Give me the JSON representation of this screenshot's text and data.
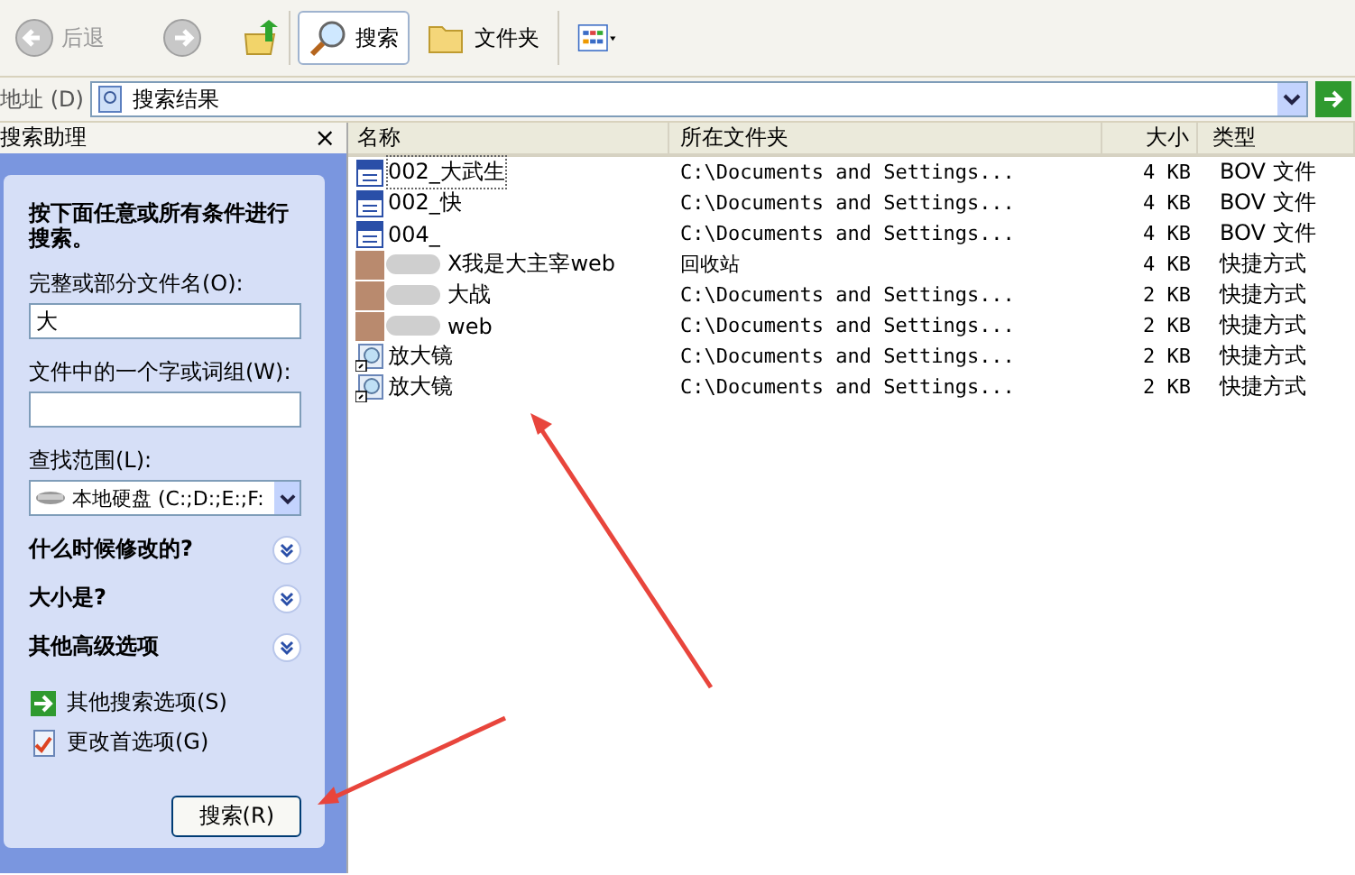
{
  "toolbar": {
    "back": "后退",
    "search": "搜索",
    "folders": "文件夹"
  },
  "address": {
    "label": "地址 (D)",
    "value": "搜索结果"
  },
  "search_pane": {
    "title": "搜索助理",
    "close": "×",
    "intro": "按下面任意或所有条件进行搜索。",
    "fields": [
      {
        "label": "完整或部分文件名(O):",
        "value": "大"
      },
      {
        "label": "文件中的一个字或词组(W):"
      }
    ],
    "scope": {
      "label": "查找范围(L):",
      "value": "本地硬盘 (C:;D:;E:;F:"
    },
    "sections": [
      "什么时候修改的?",
      "大小是?",
      "其他高级选项"
    ],
    "links": [
      {
        "kind": "arrow",
        "label": "其他搜索选项(S)"
      },
      {
        "kind": "check",
        "label": "更改首选项(G)"
      }
    ],
    "button": "搜索(R)"
  },
  "table": {
    "columns": [
      "名称",
      "所在文件夹",
      "大小",
      "类型"
    ],
    "rows": [
      {
        "kind": "bov",
        "name": "002_大武生",
        "folder": "C:\\Documents and Settings...",
        "size": "4 KB",
        "type": "BOV 文件",
        "selected": true
      },
      {
        "kind": "bov",
        "name": "002_快",
        "folder": "C:\\Documents and Settings...",
        "size": "4 KB",
        "type": "BOV 文件",
        "selected": false
      },
      {
        "kind": "bov",
        "name": "004_",
        "folder": "C:\\Documents and Settings...",
        "size": "4 KB",
        "type": "BOV 文件",
        "selected": false
      },
      {
        "kind": "blur",
        "name": "X我是大主宰web",
        "folder": "回收站",
        "size": "4 KB",
        "type": "快捷方式",
        "selected": false
      },
      {
        "kind": "blur",
        "name": "大战",
        "folder": "C:\\Documents and Settings...",
        "size": "2 KB",
        "type": "快捷方式",
        "selected": false
      },
      {
        "kind": "blur",
        "name": "web",
        "folder": "C:\\Documents and Settings...",
        "size": "2 KB",
        "type": "快捷方式",
        "selected": false
      },
      {
        "kind": "shortcut",
        "name": "放大镜",
        "folder": "C:\\Documents and Settings...",
        "size": "2 KB",
        "type": "快捷方式",
        "selected": false
      },
      {
        "kind": "shortcut",
        "name": "放大镜",
        "folder": "C:\\Documents and Settings...",
        "size": "2 KB",
        "type": "快捷方式",
        "selected": false
      }
    ]
  }
}
